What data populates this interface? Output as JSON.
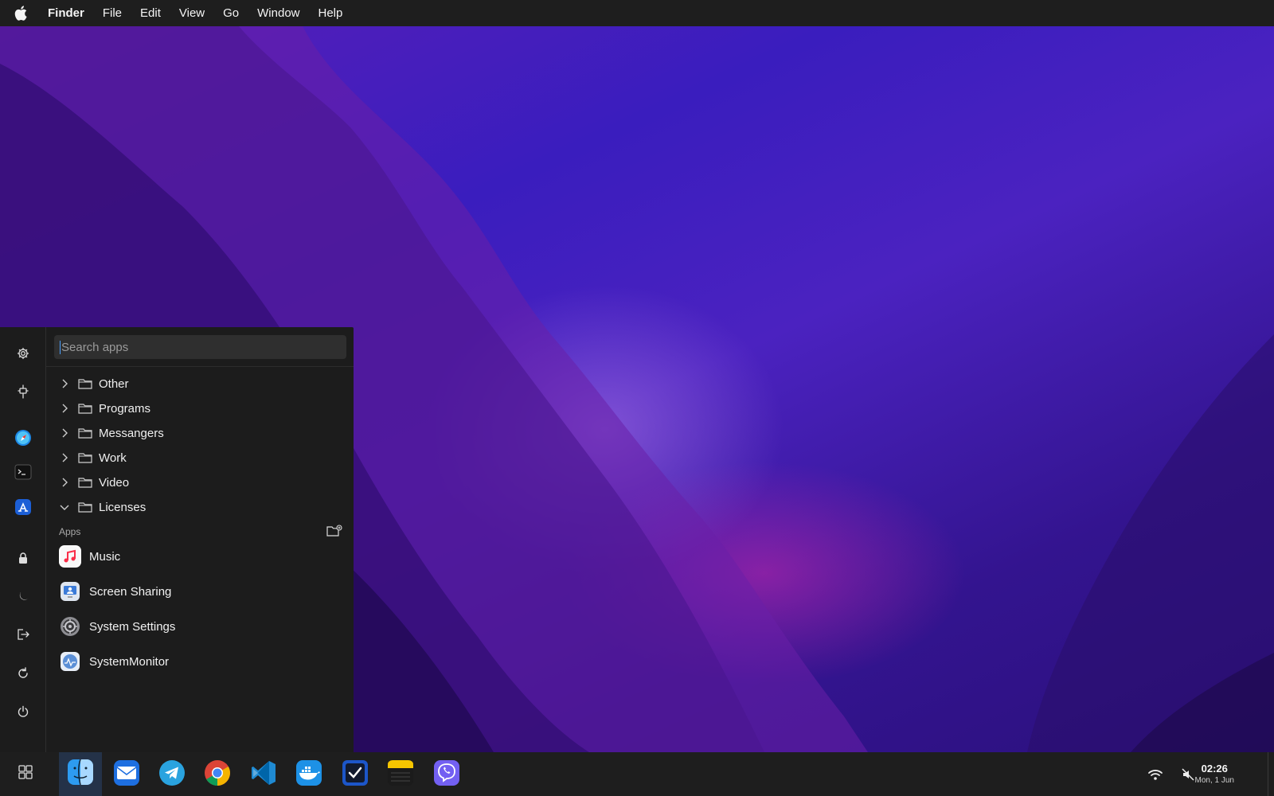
{
  "menubar": {
    "apple_icon": "apple-logo-icon",
    "app_name": "Finder",
    "items": [
      "File",
      "Edit",
      "View",
      "Go",
      "Window",
      "Help"
    ]
  },
  "launcher": {
    "search": {
      "placeholder": "Search apps",
      "value": ""
    },
    "rail_icons": [
      "gear-icon",
      "pin-icon",
      "safari-icon",
      "terminal-icon",
      "app-store-icon",
      "lock-icon",
      "moon-icon",
      "logout-icon",
      "restart-icon",
      "power-icon"
    ],
    "folders": [
      {
        "label": "Other",
        "expanded": false
      },
      {
        "label": "Programs",
        "expanded": false
      },
      {
        "label": "Messangers",
        "expanded": false
      },
      {
        "label": "Work",
        "expanded": false
      },
      {
        "label": "Video",
        "expanded": false
      },
      {
        "label": "Licenses",
        "expanded": true
      }
    ],
    "apps_section_label": "Apps",
    "apps": [
      {
        "label": "Music",
        "icon": "music-icon"
      },
      {
        "label": "Screen Sharing",
        "icon": "screen-sharing-icon"
      },
      {
        "label": "System Settings",
        "icon": "system-settings-icon"
      },
      {
        "label": "SystemMonitor",
        "icon": "system-monitor-icon"
      }
    ]
  },
  "taskbar": {
    "apps": [
      "finder-icon",
      "mail-icon",
      "telegram-icon",
      "chrome-icon",
      "vscode-icon",
      "docker-icon",
      "tasks-icon",
      "notes-icon",
      "viber-icon"
    ],
    "tray": [
      "wifi-icon",
      "muted-speaker-icon"
    ],
    "clock": {
      "time": "02:26",
      "date": "Mon, 1 Jun"
    }
  },
  "colors": {
    "accent": "#4aa0ff",
    "panel": "#1c1c1c",
    "taskbar": "#1e1e1e",
    "menubar": "#1e1e1e"
  }
}
